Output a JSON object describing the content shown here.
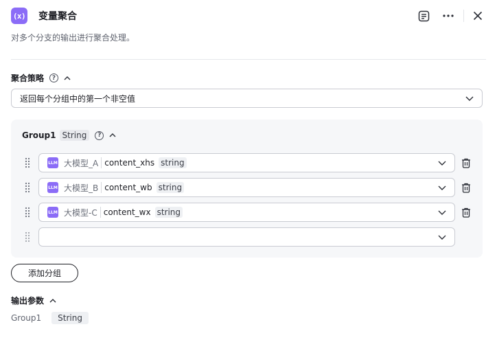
{
  "header": {
    "icon_label": "(x)",
    "title": "变量聚合",
    "icons": [
      "notes-icon",
      "more-icon",
      "close-icon"
    ]
  },
  "description": "对多个分支的输出进行聚合处理。",
  "strategy": {
    "title": "聚合策略",
    "help": "?",
    "selected": "返回每个分组中的第一个非空值"
  },
  "group": {
    "name": "Group1",
    "type": "String",
    "help": "?",
    "rows": [
      {
        "badge": "LLM",
        "node": "大模型_A",
        "var": "content_xhs",
        "type": "string"
      },
      {
        "badge": "LLM",
        "node": "大模型_B",
        "var": "content_wb",
        "type": "string"
      },
      {
        "badge": "LLM",
        "node": "大模型-C",
        "var": "content_wx",
        "type": "string"
      }
    ]
  },
  "add_group_label": "添加分组",
  "output": {
    "title": "输出参数",
    "name": "Group1",
    "type": "String"
  },
  "colors": {
    "accent": "#8b6cf7",
    "panel": "#f6f7f9",
    "border": "#c9cbd2"
  }
}
